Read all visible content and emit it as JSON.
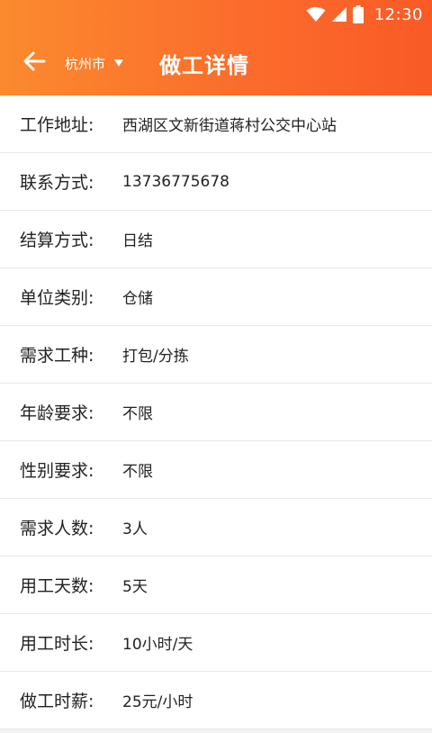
{
  "status_bar": {
    "time": "12:30",
    "icons": [
      "wifi-icon",
      "signal-icon",
      "battery-icon"
    ]
  },
  "header": {
    "back_icon": "arrow-left-icon",
    "city": "杭州市",
    "title": "做工详情"
  },
  "colors": {
    "header_gradient_start": "#fb8a2e",
    "header_gradient_end": "#fa5a26",
    "background": "#f2f2f2"
  },
  "details": [
    {
      "label": "工作地址:",
      "value": "西湖区文新街道蒋村公交中心站"
    },
    {
      "label": "联系方式:",
      "value": "13736775678"
    },
    {
      "label": "结算方式:",
      "value": "日结"
    },
    {
      "label": "单位类别:",
      "value": "仓储"
    },
    {
      "label": "需求工种:",
      "value": "打包/分拣"
    },
    {
      "label": "年龄要求:",
      "value": "不限"
    },
    {
      "label": "性别要求:",
      "value": "不限"
    },
    {
      "label": "需求人数:",
      "value": "3人"
    },
    {
      "label": "用工天数:",
      "value": "5天"
    },
    {
      "label": "用工时长:",
      "value": "10小时/天"
    },
    {
      "label": "做工时薪:",
      "value": "25元/小时"
    }
  ]
}
